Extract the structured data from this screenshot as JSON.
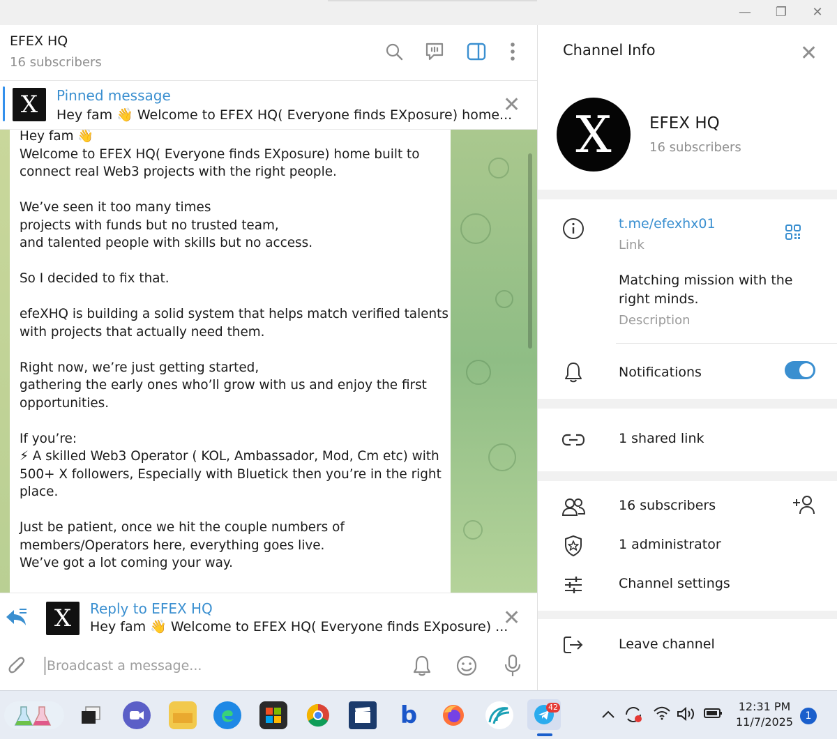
{
  "chat": {
    "title": "EFEX HQ",
    "subscribers": "16 subscribers",
    "pinned": {
      "label": "Pinned message",
      "text": "Hey fam 👋 Welcome to EFEX HQ( Everyone finds EXposure) home..."
    },
    "message": [
      "Hey fam 👋\nWelcome to EFEX HQ( Everyone finds EXposure) home built to\nconnect real Web3 projects with the right people.",
      "We’ve seen it too many times\nprojects with funds but no trusted team,\nand talented people with skills but no access.",
      "So I decided to fix that.",
      "efeXHQ is building a solid system that helps match verified talents\nwith projects that actually need them.",
      "Right now, we’re just getting started,\ngathering the early ones who’ll grow with us and enjoy the first\nopportunities.",
      "If you’re:\n⚡  A skilled Web3 Operator ( KOL, Ambassador, Mod, Cm etc) with\n500+ X followers, Especially with Bluetick then you’re in the right\nplace.",
      "Just be patient, once we hit the couple numbers of\nmembers/Operators here, everything goes live.\nWe’ve got a lot coming your way."
    ],
    "reply": {
      "label": "Reply to EFEX HQ",
      "text": "Hey fam 👋 Welcome to EFEX HQ( Everyone finds EXposure) ..."
    },
    "composer_placeholder": "Broadcast a message..."
  },
  "info": {
    "title": "Channel Info",
    "name": "EFEX HQ",
    "subscribers": "16 subscribers",
    "link": "t.me/efexhx01",
    "link_label": "Link",
    "description": "Matching mission with the\nright minds.",
    "description_label": "Description",
    "notifications": "Notifications",
    "notifications_on": true,
    "shared_links": "1 shared link",
    "subscribers_row": "16 subscribers",
    "administrators": "1 administrator",
    "settings": "Channel settings",
    "leave": "Leave channel"
  },
  "taskbar": {
    "time": "12:31 PM",
    "date": "11/7/2025",
    "telegram_badge": "42",
    "notification_count": "1"
  },
  "colors": {
    "accent": "#3a8fd0",
    "wallpaper": "#9fc48a"
  },
  "icons": {
    "avatar_letter": "X"
  }
}
